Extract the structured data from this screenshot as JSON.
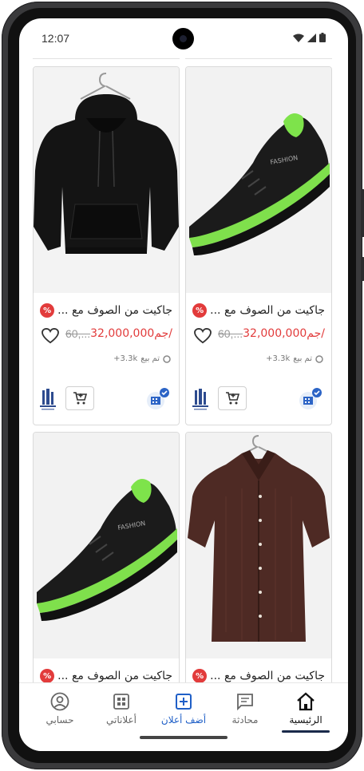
{
  "status_bar": {
    "time": "12:07"
  },
  "products": [
    {
      "id": "p1",
      "title": "جاكيت من الصوف مع ...",
      "old_price": "60,...",
      "new_price": "32,000,000جم/",
      "sold": "تم بيع",
      "sold_count": "+3.3k",
      "discount_symbol": "%",
      "image": "black-hoodie"
    },
    {
      "id": "p2",
      "title": "جاكيت من الصوف مع ...",
      "old_price": "60,...",
      "new_price": "32,000,000جم/",
      "sold": "تم بيع",
      "sold_count": "+3.3k",
      "discount_symbol": "%",
      "image": "black-sneaker"
    },
    {
      "id": "p3",
      "title": "جاكيت من الصوف مع ...",
      "image": "black-sneaker",
      "discount_symbol": "%"
    },
    {
      "id": "p4",
      "title": "جاكيت من الصوف مع ...",
      "image": "brown-shirt",
      "discount_symbol": "%"
    }
  ],
  "bottom_nav": {
    "items": [
      {
        "label": "حسابي",
        "icon": "account-icon"
      },
      {
        "label": "أعلاناتي",
        "icon": "grid-icon"
      },
      {
        "label": "أضف أعلان",
        "icon": "add-box-icon"
      },
      {
        "label": "محادثة",
        "icon": "chat-icon"
      },
      {
        "label": "الرئيسية",
        "icon": "home-icon"
      }
    ]
  },
  "colors": {
    "accent": "#1f5fc7",
    "price": "#e23b3b",
    "badge": "#e23b3b",
    "nav_active": "#1a2a4a"
  }
}
